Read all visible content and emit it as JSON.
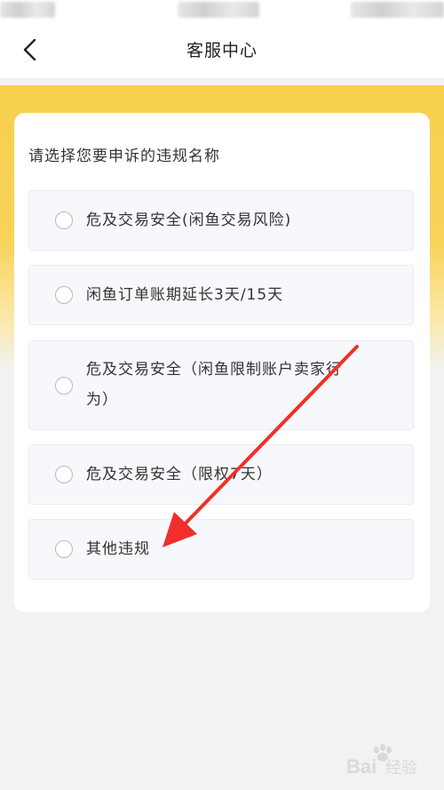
{
  "status_bar": {},
  "nav": {
    "title": "客服中心",
    "back_icon": "chevron-left-icon"
  },
  "card": {
    "title": "请选择您要申诉的违规名称",
    "options": [
      {
        "label_lines": [
          "危及交易安全(闲鱼交易风险)"
        ],
        "selected": false
      },
      {
        "label_lines": [
          "闲鱼订单账期延长3天/15天"
        ],
        "selected": false
      },
      {
        "label_lines": [
          "危及交易安全（闲鱼限制账户卖家行",
          "为）"
        ],
        "selected": false
      },
      {
        "label_lines": [
          "危及交易安全（限权7天）"
        ],
        "selected": false
      },
      {
        "label_lines": [
          "其他违规"
        ],
        "selected": false
      }
    ]
  },
  "colors": {
    "accent_yellow": "#f7cf4d",
    "annotation_arrow": "#f12f2a",
    "page_bg": "#f2f2f2"
  },
  "watermark": {
    "text": "Bai",
    "text2": "经验"
  }
}
